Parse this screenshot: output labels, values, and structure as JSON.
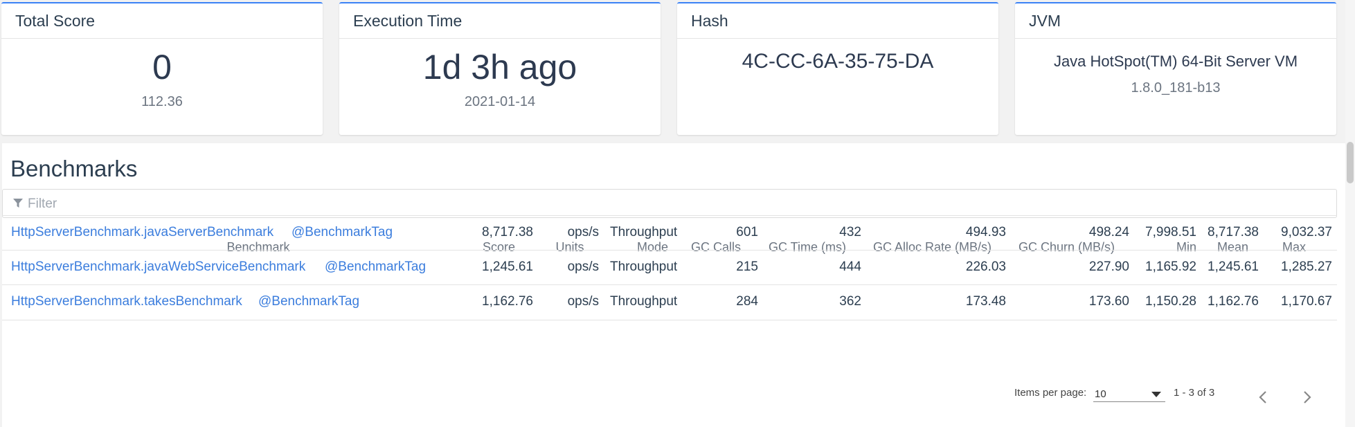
{
  "cards": {
    "total_score": {
      "title": "Total Score",
      "value": "0",
      "sub": "112.36"
    },
    "execution_time": {
      "title": "Execution Time",
      "value": "1d 3h ago",
      "sub": "2021-01-14"
    },
    "hash": {
      "title": "Hash",
      "value": "4C-CC-6A-35-75-DA"
    },
    "jvm": {
      "title": "JVM",
      "value": "Java HotSpot(TM) 64-Bit Server VM",
      "sub": "1.8.0_181-b13"
    }
  },
  "benchmarks": {
    "title": "Benchmarks",
    "filter_placeholder": "Filter",
    "filter_icon": "filter-icon",
    "columns": {
      "benchmark": "Benchmark",
      "score": "Score",
      "units": "Units",
      "mode": "Mode",
      "gc_calls": "GC Calls",
      "gc_time": "GC Time (ms)",
      "gc_alloc": "GC Alloc Rate (MB/s)",
      "gc_churn": "GC Churn (MB/s)",
      "min": "Min",
      "mean": "Mean",
      "max": "Max"
    },
    "rows": [
      {
        "name": "HttpServerBenchmark.javaServerBenchmark",
        "tag": "@BenchmarkTag",
        "score": "8,717.38",
        "units": "ops/s",
        "mode": "Throughput",
        "gc_calls": "601",
        "gc_time": "432",
        "gc_alloc": "494.93",
        "gc_churn": "498.24",
        "min": "7,998.51",
        "mean": "8,717.38",
        "max": "9,032.37"
      },
      {
        "name": "HttpServerBenchmark.javaWebServiceBenchmark",
        "tag": "@BenchmarkTag",
        "score": "1,245.61",
        "units": "ops/s",
        "mode": "Throughput",
        "gc_calls": "215",
        "gc_time": "444",
        "gc_alloc": "226.03",
        "gc_churn": "227.90",
        "min": "1,165.92",
        "mean": "1,245.61",
        "max": "1,285.27"
      },
      {
        "name": "HttpServerBenchmark.takesBenchmark",
        "tag": "@BenchmarkTag",
        "score": "1,162.76",
        "units": "ops/s",
        "mode": "Throughput",
        "gc_calls": "284",
        "gc_time": "362",
        "gc_alloc": "173.48",
        "gc_churn": "173.60",
        "min": "1,150.28",
        "mean": "1,162.76",
        "max": "1,170.67"
      }
    ]
  },
  "paginator": {
    "items_per_page_label": "Items per page:",
    "items_per_page_value": "10",
    "range_label": "1 - 3 of 3"
  },
  "colors": {
    "accent": "#3b82f6",
    "link": "#3b7ddd"
  }
}
